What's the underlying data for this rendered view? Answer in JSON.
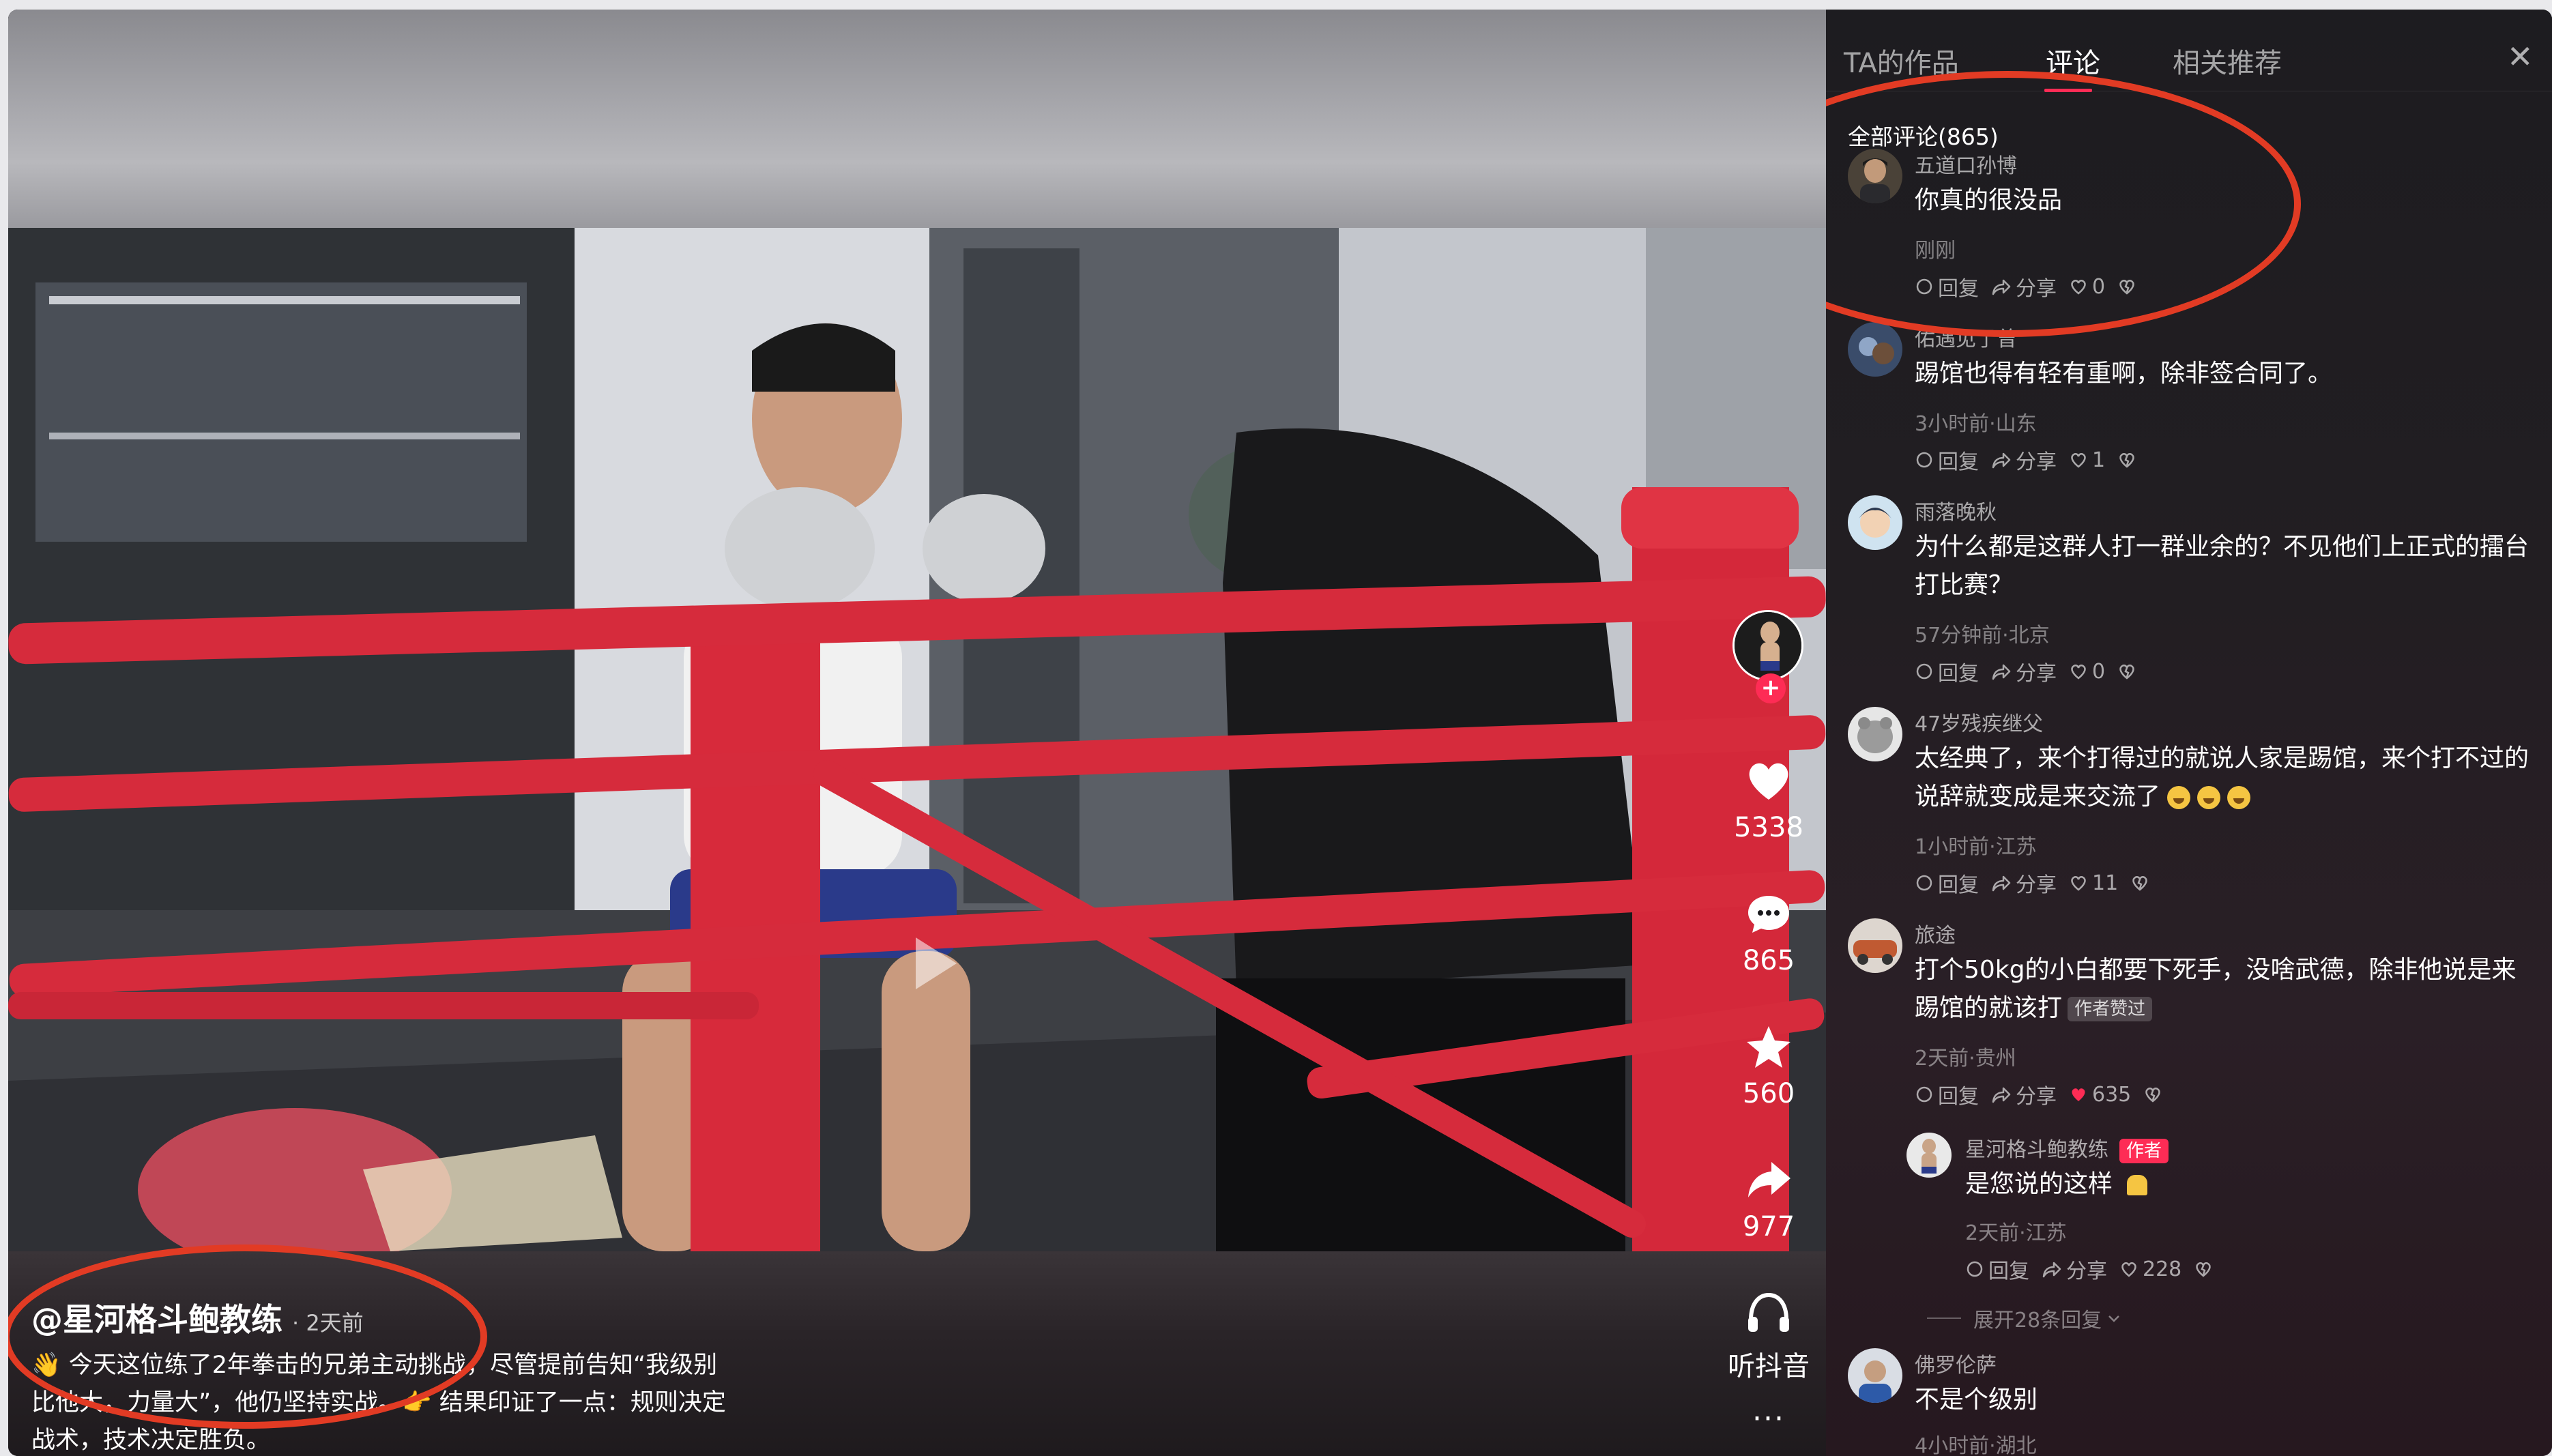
{
  "video": {
    "author": "@星河格斗鲍教练",
    "time": "· 2天前",
    "caption": "👋 今天这位练了2年拳击的兄弟主动挑战，尽管提前告知“我级别比他大，力量大”，他仍坚持实战。👉 结果印证了一点：规则决定战术，技术决定胜负。",
    "actions": {
      "likes": "5338",
      "comments": "865",
      "favorites": "560",
      "shares": "977",
      "listen": "听抖音",
      "more": "···"
    }
  },
  "panel": {
    "tabs": [
      "TA的作品",
      "评论",
      "相关推荐"
    ],
    "active_tab": "评论",
    "comments_title": "全部评论(865)",
    "comments": [
      {
        "name": "五道口孙博",
        "text": "你真的很没品",
        "meta": "刚刚",
        "likes": "0"
      },
      {
        "name": "佑遇见了曾",
        "text": "踢馆也得有轻有重啊，除非签合同了。",
        "meta": "3小时前·山东",
        "likes": "1"
      },
      {
        "name": "雨落晚秋",
        "text": "为什么都是这群人打一群业余的？不见他们上正式的擂台打比赛？",
        "meta": "57分钟前·北京",
        "likes": "0"
      },
      {
        "name": "47岁残疾继父",
        "text": "太经典了，来个打得过的就说人家是踢馆，来个打不过的说辞就变成是来交流了",
        "meta": "1小时前·江苏",
        "likes": "11"
      },
      {
        "name": "旅途",
        "text": "打个50kg的小白都要下死手，没啥武德，除非他说是来踢馆的就该打",
        "badge": "作者赞过",
        "meta": "2天前·贵州",
        "likes": "635"
      },
      {
        "name": "星河格斗鲍教练",
        "tag": "作者",
        "text": "是您说的这样",
        "meta": "2天前·江苏",
        "likes": "228"
      },
      {
        "name": "佛罗伦萨",
        "text": "不是个级别",
        "meta": "4小时前·湖北"
      }
    ],
    "reply_label": "回复",
    "share_label": "分享",
    "expand_replies": "展开28条回复"
  },
  "colors": {
    "accent": "#fe2c55",
    "annotation": "#e23b24"
  }
}
